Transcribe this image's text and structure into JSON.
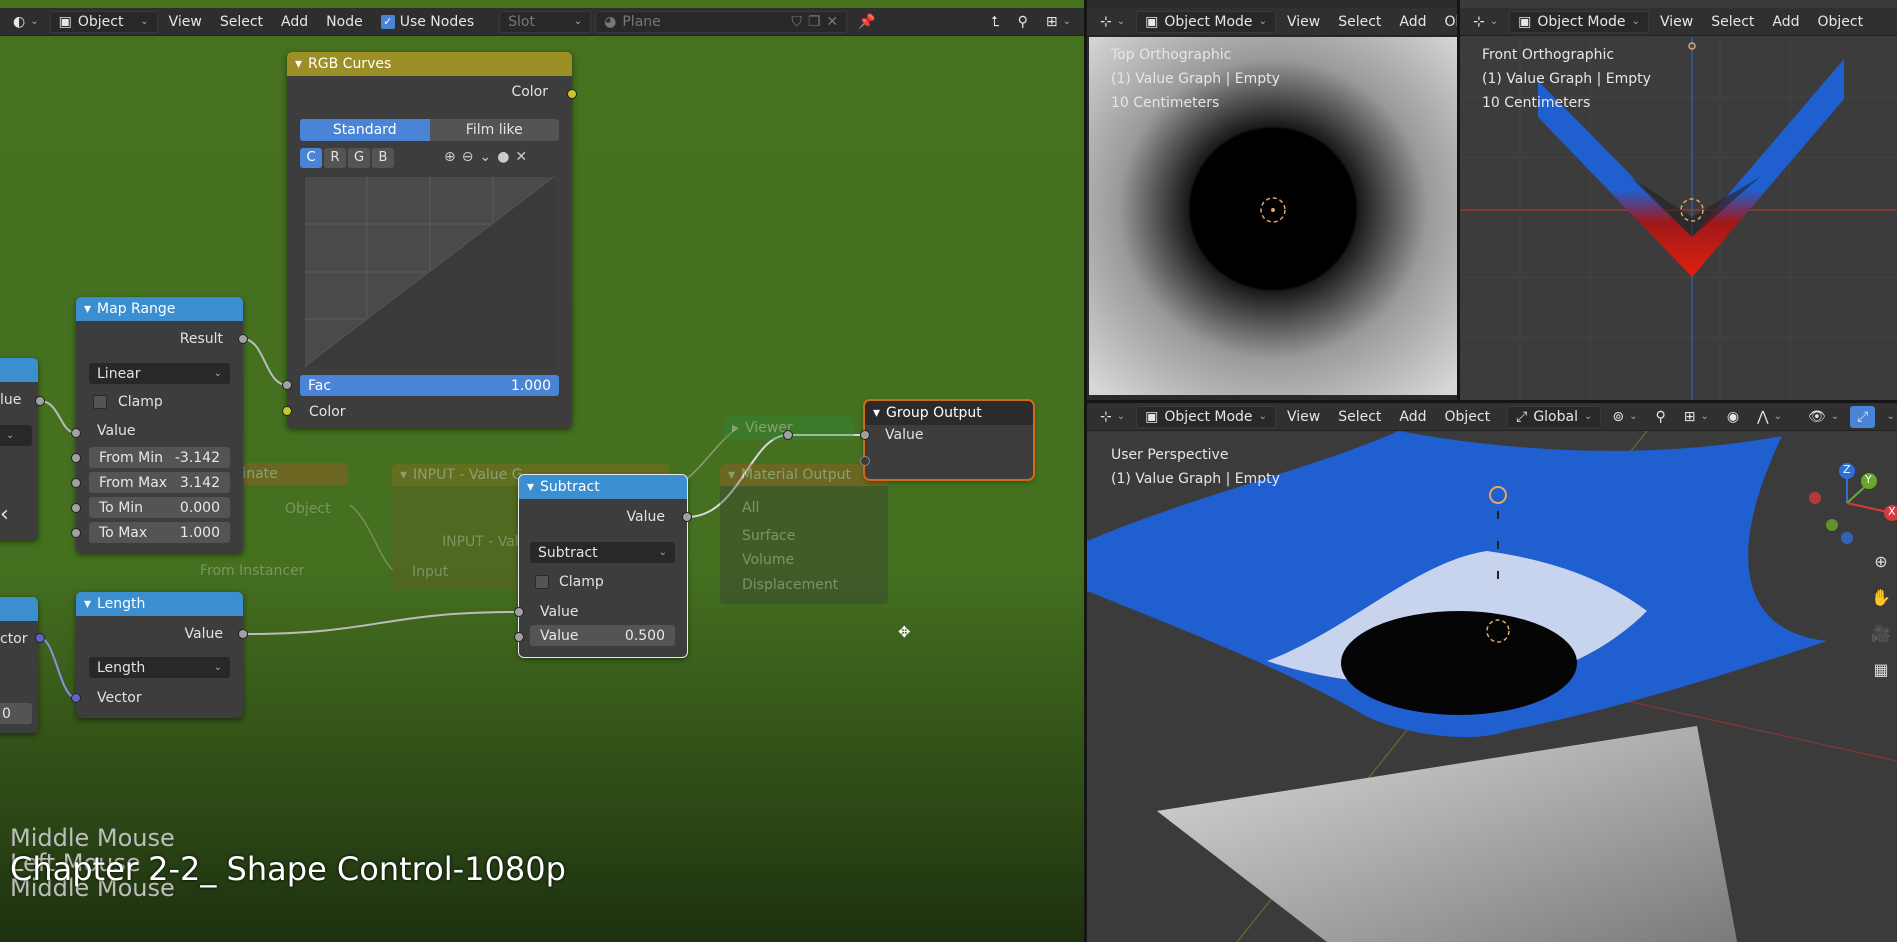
{
  "node_editor_header": {
    "mode": "Object",
    "menus": [
      "View",
      "Select",
      "Add",
      "Node"
    ],
    "use_nodes_label": "Use Nodes",
    "slot_placeholder": "Slot",
    "material_placeholder": "Plane"
  },
  "nodes": {
    "rgb_curves": {
      "title": "RGB Curves",
      "output_color": "Color",
      "tab_standard": "Standard",
      "tab_film": "Film like",
      "channels": [
        "C",
        "R",
        "G",
        "B"
      ],
      "fac_label": "Fac",
      "fac_value": "1.000",
      "input_color": "Color"
    },
    "map_range": {
      "title": "Map Range",
      "output": "Result",
      "mode": "Linear",
      "clamp_label": "Clamp",
      "value_label": "Value",
      "from_min_label": "From Min",
      "from_min": "-3.142",
      "from_max_label": "From Max",
      "from_max": "3.142",
      "to_min_label": "To Min",
      "to_min": "0.000",
      "to_max_label": "To Max",
      "to_max": "1.000"
    },
    "length": {
      "title": "Length",
      "output": "Value",
      "mode": "Length",
      "input": "Vector"
    },
    "subtract": {
      "title": "Subtract",
      "output": "Value",
      "mode": "Subtract",
      "clamp_label": "Clamp",
      "input_value": "Value",
      "value_label": "Value",
      "value": "0.500"
    },
    "group_output": {
      "title": "Group Output",
      "input": "Value"
    },
    "ghost": {
      "coordinate_title": "Coordinate",
      "coordinate_object": "Object",
      "coordinate_from_instancer": "From Instancer",
      "input_value_title": "INPUT - Value G...",
      "input_value_field": "INPUT - Val...",
      "input_value_input": "Input",
      "viewer_title": "Viewer",
      "material_output_title": "Material Output",
      "material_output_target": "All",
      "material_output_surface": "Surface",
      "material_output_volume": "Volume",
      "material_output_displacement": "Displacement"
    },
    "partial_left": {
      "value_label": "lue",
      "vector_label": "ctor",
      "number_label": "0"
    }
  },
  "overlay": {
    "line1": "Middle Mouse",
    "line2": "Left Mouse",
    "line3": "Middle Mouse",
    "title": "Chapter 2-2_ Shape Control-1080p"
  },
  "viewports": {
    "top": {
      "mode": "Object Mode",
      "menus": [
        "View",
        "Select",
        "Add",
        "Obje"
      ],
      "view_name": "Top Orthographic",
      "object_info": "(1) Value Graph | Empty",
      "scale": "10 Centimeters"
    },
    "front": {
      "mode": "Object Mode",
      "menus": [
        "View",
        "Select",
        "Add",
        "Object"
      ],
      "view_name": "Front Orthographic",
      "object_info": "(1) Value Graph | Empty",
      "scale": "10 Centimeters"
    },
    "persp": {
      "mode": "Object Mode",
      "menus": [
        "View",
        "Select",
        "Add",
        "Object"
      ],
      "transform": "Global",
      "view_name": "User Perspective",
      "object_info": "(1) Value Graph | Empty",
      "gizmo": {
        "x": "X",
        "y": "Y",
        "z": "Z"
      }
    }
  },
  "colors": {
    "node_bg": "#3d3d3d",
    "header_blue": "#3b8ed0",
    "header_yellow": "#9c8f26",
    "editor_green": "#46711f",
    "surface_blue": "#1f5fd0"
  }
}
